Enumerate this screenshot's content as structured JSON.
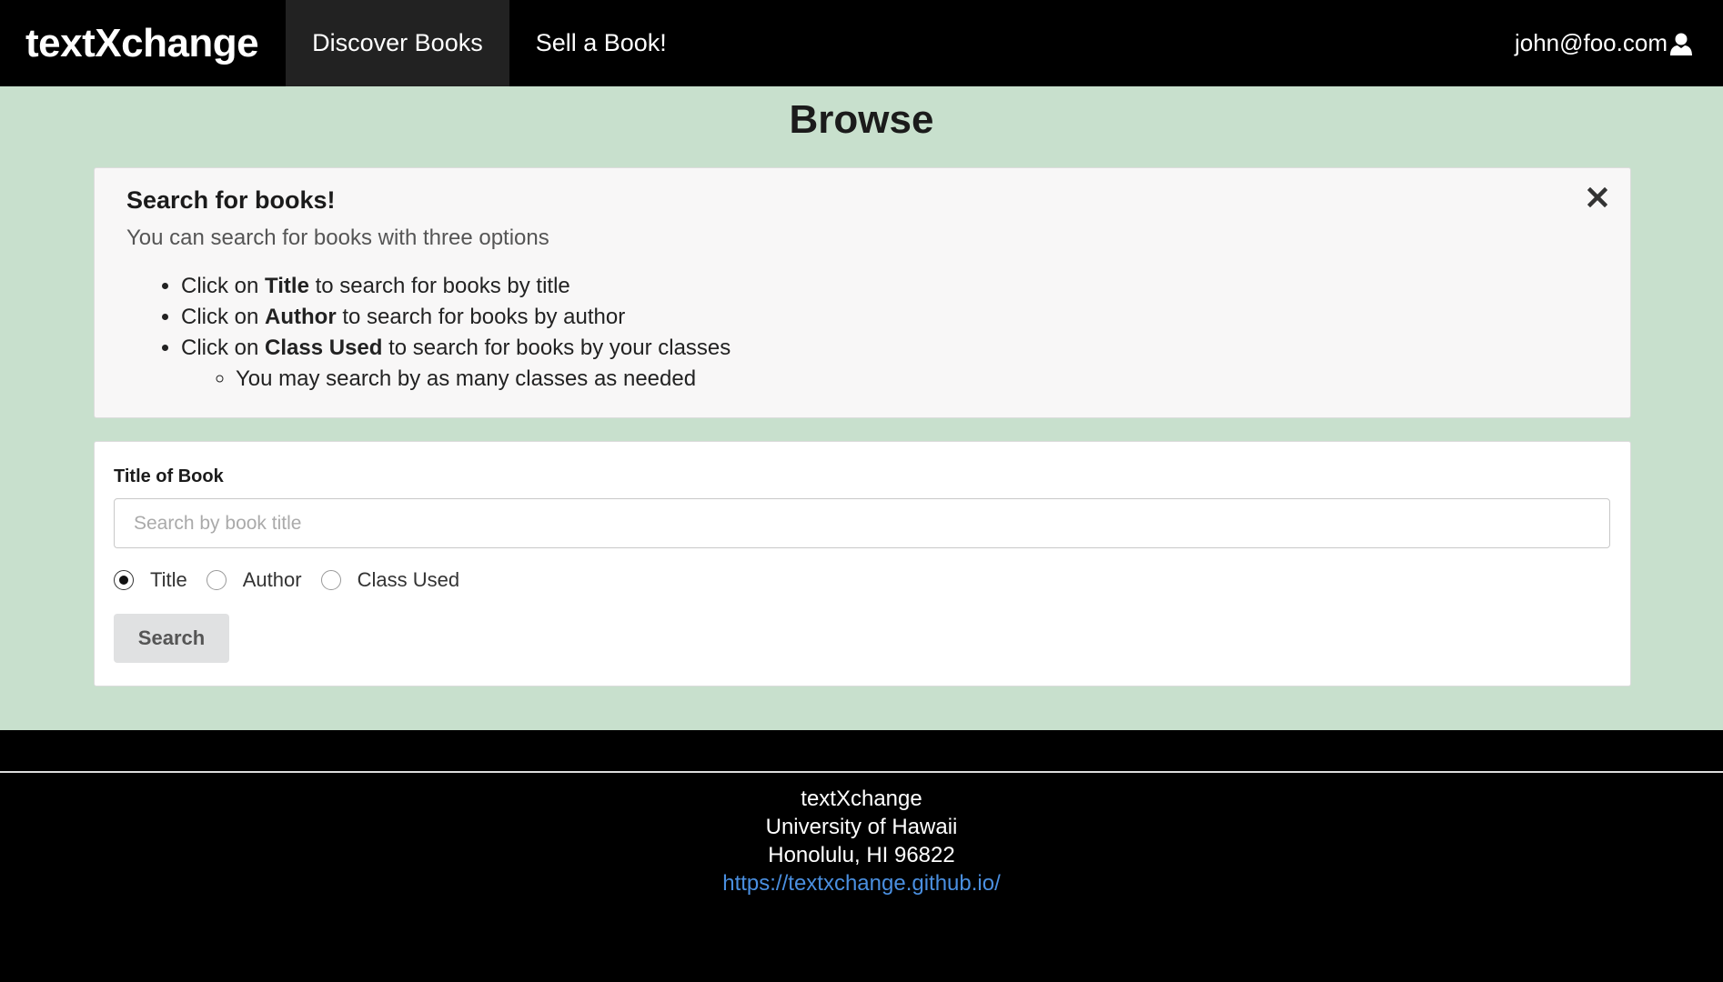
{
  "navbar": {
    "brand": "textXchange",
    "items": [
      {
        "label": "Discover Books",
        "active": true
      },
      {
        "label": "Sell a Book!",
        "active": false
      }
    ],
    "user": "john@foo.com"
  },
  "main": {
    "title": "Browse",
    "info": {
      "title": "Search for books!",
      "subtitle": "You can search for books with three options",
      "items": [
        {
          "prefix": "Click on ",
          "bold": "Title",
          "suffix": " to search for books by title"
        },
        {
          "prefix": "Click on ",
          "bold": "Author",
          "suffix": " to search for books by author"
        },
        {
          "prefix": "Click on ",
          "bold": "Class Used",
          "suffix": " to search for books by your classes"
        }
      ],
      "subitem": "You may search by as many classes as needed"
    },
    "search": {
      "label": "Title of Book",
      "placeholder": "Search by book title",
      "value": "",
      "options": [
        {
          "label": "Title",
          "checked": true
        },
        {
          "label": "Author",
          "checked": false
        },
        {
          "label": "Class Used",
          "checked": false
        }
      ],
      "button_label": "Search"
    }
  },
  "footer": {
    "line1": "textXchange",
    "line2": "University of Hawaii",
    "line3": "Honolulu, HI 96822",
    "link": "https://textxchange.github.io/"
  },
  "colors": {
    "background": "#c8e0cd",
    "navbar": "#000000",
    "link": "#4a8fe0"
  }
}
